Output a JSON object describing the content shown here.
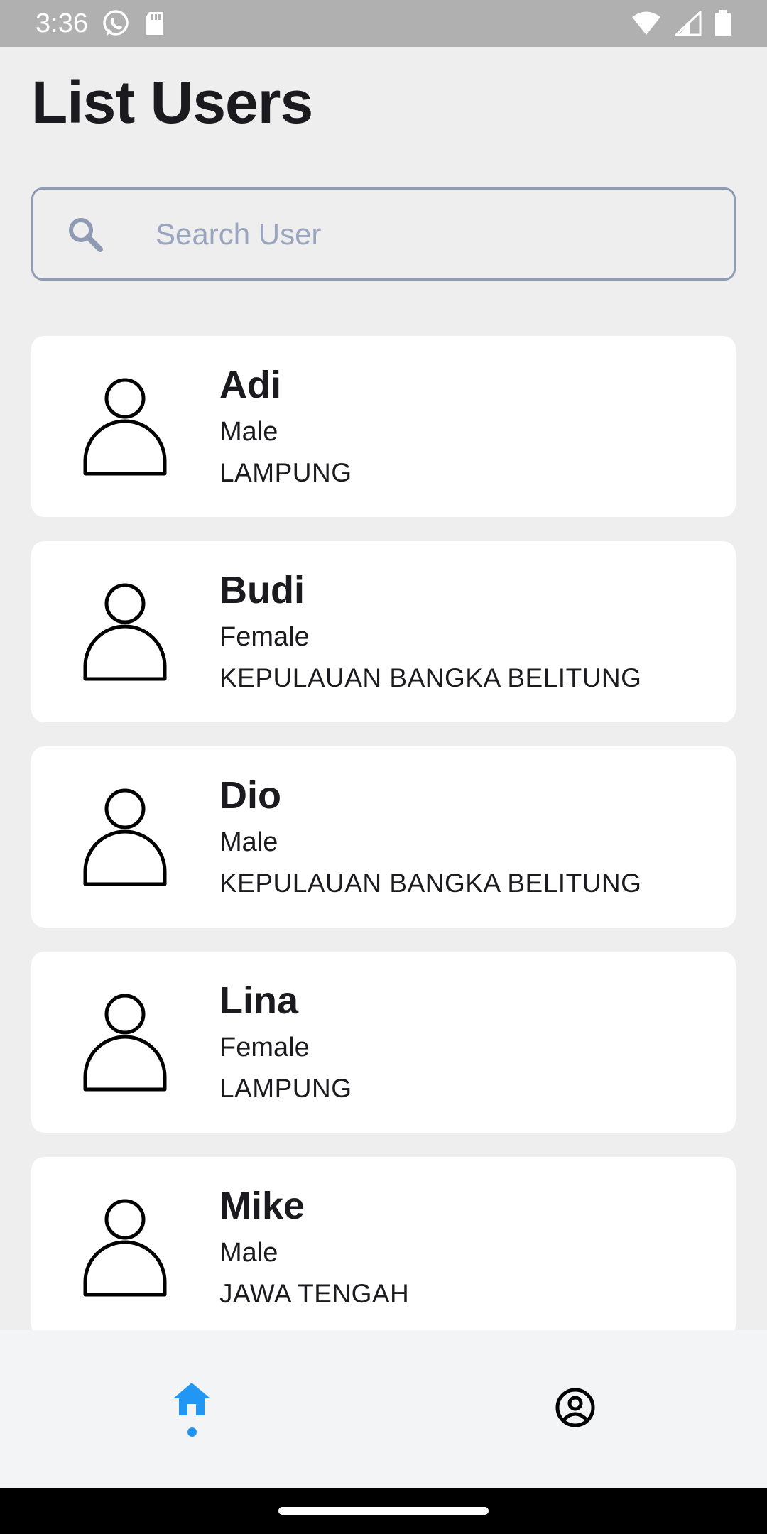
{
  "status_bar": {
    "time": "3:36",
    "icons": [
      "whatsapp-icon",
      "sd-card-icon",
      "wifi-icon",
      "cellular-icon",
      "battery-icon"
    ]
  },
  "page": {
    "title": "List Users"
  },
  "search": {
    "placeholder": "Search User",
    "value": "",
    "icon": "search-icon"
  },
  "users": [
    {
      "name": "Adi",
      "gender": "Male",
      "region": "LAMPUNG"
    },
    {
      "name": "Budi",
      "gender": "Female",
      "region": "KEPULAUAN BANGKA BELITUNG"
    },
    {
      "name": "Dio",
      "gender": "Male",
      "region": "KEPULAUAN BANGKA BELITUNG"
    },
    {
      "name": "Lina",
      "gender": "Female",
      "region": "LAMPUNG"
    },
    {
      "name": "Mike",
      "gender": "Male",
      "region": "JAWA TENGAH"
    }
  ],
  "bottom_nav": {
    "items": [
      {
        "icon": "home-icon",
        "active": true
      },
      {
        "icon": "profile-icon",
        "active": false
      }
    ],
    "active_color": "#2196f3"
  },
  "colors": {
    "background": "#eeeeee",
    "card": "#ffffff",
    "status_bar": "#b0b0b0",
    "accent": "#2196f3"
  }
}
